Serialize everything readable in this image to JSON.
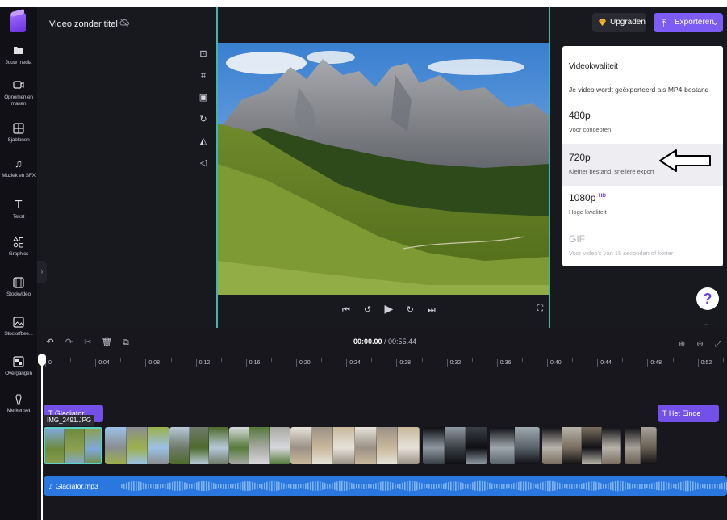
{
  "app": {
    "project_title": "Video zonder titel",
    "upgrade_label": "Upgraden",
    "export_label": "Exporteren"
  },
  "sidebar": {
    "items": [
      {
        "label": "Jouw media",
        "icon": "folder-icon"
      },
      {
        "label": "Opnemen en maken",
        "icon": "camera-icon"
      },
      {
        "label": "Sjablonen",
        "icon": "templates-icon"
      },
      {
        "label": "Muziek en SFX",
        "icon": "music-icon"
      },
      {
        "label": "Tekst",
        "icon": "text-icon"
      },
      {
        "label": "Graphics",
        "icon": "shapes-icon"
      },
      {
        "label": "Stockvideo",
        "icon": "film-icon"
      },
      {
        "label": "Stockafbee...",
        "icon": "image-icon"
      },
      {
        "label": "Overgangen",
        "icon": "transition-icon"
      },
      {
        "label": "Merkenset",
        "icon": "brand-kit-icon"
      }
    ]
  },
  "export_menu": {
    "heading": "Videokwaliteit",
    "description": "Je video wordt geëxporteerd als MP4-bestand",
    "options": [
      {
        "title": "480p",
        "desc": "Voor concepten",
        "badge": "",
        "state": "normal"
      },
      {
        "title": "720p",
        "desc": "Kleiner bestand, snellere export",
        "badge": "",
        "state": "selected"
      },
      {
        "title": "1080p",
        "desc": "Hoge kwaliteit",
        "badge": "HD",
        "state": "normal"
      },
      {
        "title": "GIF",
        "desc": "Voor video's van 15 seconden of korter",
        "badge": "",
        "state": "disabled"
      }
    ]
  },
  "help_label": "?",
  "timeline": {
    "current_time": "00:00.00",
    "total_time": "00:55.44",
    "ticks": [
      "0",
      "0:04",
      "0:08",
      "0:12",
      "0:16",
      "0:20",
      "0:24",
      "0:28",
      "0:32",
      "0:36",
      "0:40",
      "0:44",
      "0:48",
      "0:52"
    ],
    "text_clip_label": "Gladiator",
    "end_clip_label": "Het Einde",
    "selected_clip_name": "IMG_2491.JPG",
    "audio_clip_label": "Gladiator.mp3"
  },
  "colors": {
    "accent": "#7b5cf5",
    "selection": "#5fd0c5",
    "audio": "#2a77df",
    "background": "#18181f"
  }
}
